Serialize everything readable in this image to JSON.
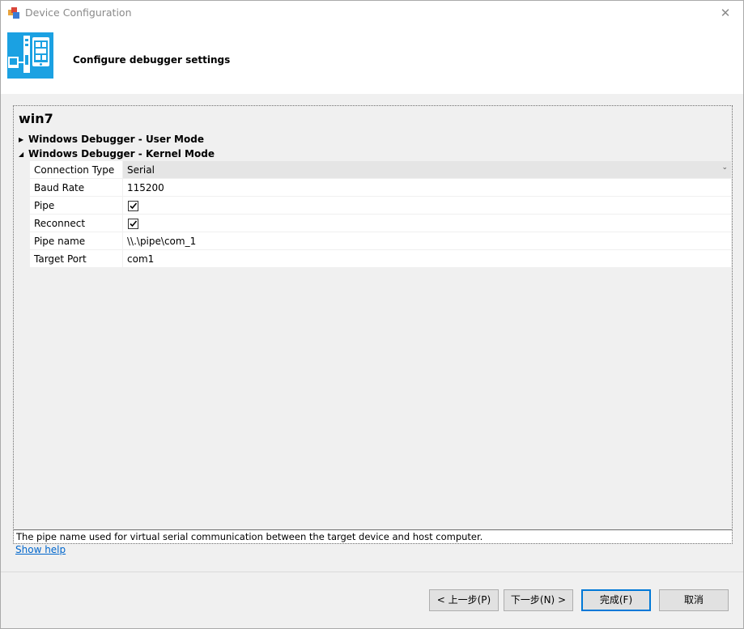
{
  "window": {
    "title": "Device Configuration",
    "close_glyph": "✕"
  },
  "header": {
    "title": "Configure debugger settings",
    "logo_icon": "device-config-icon"
  },
  "panel": {
    "device_name": "win7",
    "sections": [
      {
        "label": "Windows Debugger - User Mode",
        "expanded": false
      },
      {
        "label": "Windows Debugger - Kernel Mode",
        "expanded": true
      }
    ],
    "properties": [
      {
        "label": "Connection Type",
        "value": "Serial",
        "type": "dropdown"
      },
      {
        "label": "Baud Rate",
        "value": "115200",
        "type": "text"
      },
      {
        "label": "Pipe",
        "checked": true,
        "type": "checkbox"
      },
      {
        "label": "Reconnect",
        "checked": true,
        "type": "checkbox"
      },
      {
        "label": "Pipe name",
        "value": "\\\\.\\pipe\\com_1",
        "type": "text"
      },
      {
        "label": "Target Port",
        "value": "com1",
        "type": "text"
      }
    ],
    "description": "The pipe name used for virtual serial communication between the target device and host computer."
  },
  "show_help": "Show help",
  "buttons": {
    "back": "< 上一步(P)",
    "next": "下一步(N) >",
    "finish": "完成(F)",
    "cancel": "取消"
  },
  "colors": {
    "accent": "#1ba1e2",
    "link": "#0066cc",
    "primary_border": "#0078d7"
  }
}
